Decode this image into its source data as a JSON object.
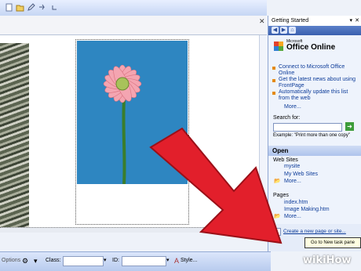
{
  "colors": {
    "accent": "#3a5fae",
    "link": "#0d3c99",
    "arrow": "#e21f2b",
    "photo_bg": "#2e86c1"
  },
  "taskpane": {
    "title": "Getting Started",
    "brand_small": "Microsoft",
    "brand": "Office Online",
    "links": [
      "Connect to Microsoft Office Online",
      "Get the latest news about using FrontPage",
      "Automatically update this list from the web"
    ],
    "more": "More...",
    "search_label": "Search for:",
    "search_example": "Example: \"Print more than one copy\"",
    "open_header": "Open",
    "web_sites_label": "Web Sites",
    "web_sites": [
      "mysite",
      "My Web Sites"
    ],
    "web_more": "More...",
    "pages_label": "Pages",
    "pages": [
      "index.htm",
      "Image Making.htm"
    ],
    "pages_more": "More...",
    "create_link": "Create a new page or site..."
  },
  "tooltip": "Go to New task pane",
  "format_bar": {
    "options_label": "Options",
    "class_label": "Class:",
    "id_label": "ID:",
    "style_label": "Style..."
  },
  "watermark": {
    "wiki": "wiki",
    "how": "How"
  }
}
